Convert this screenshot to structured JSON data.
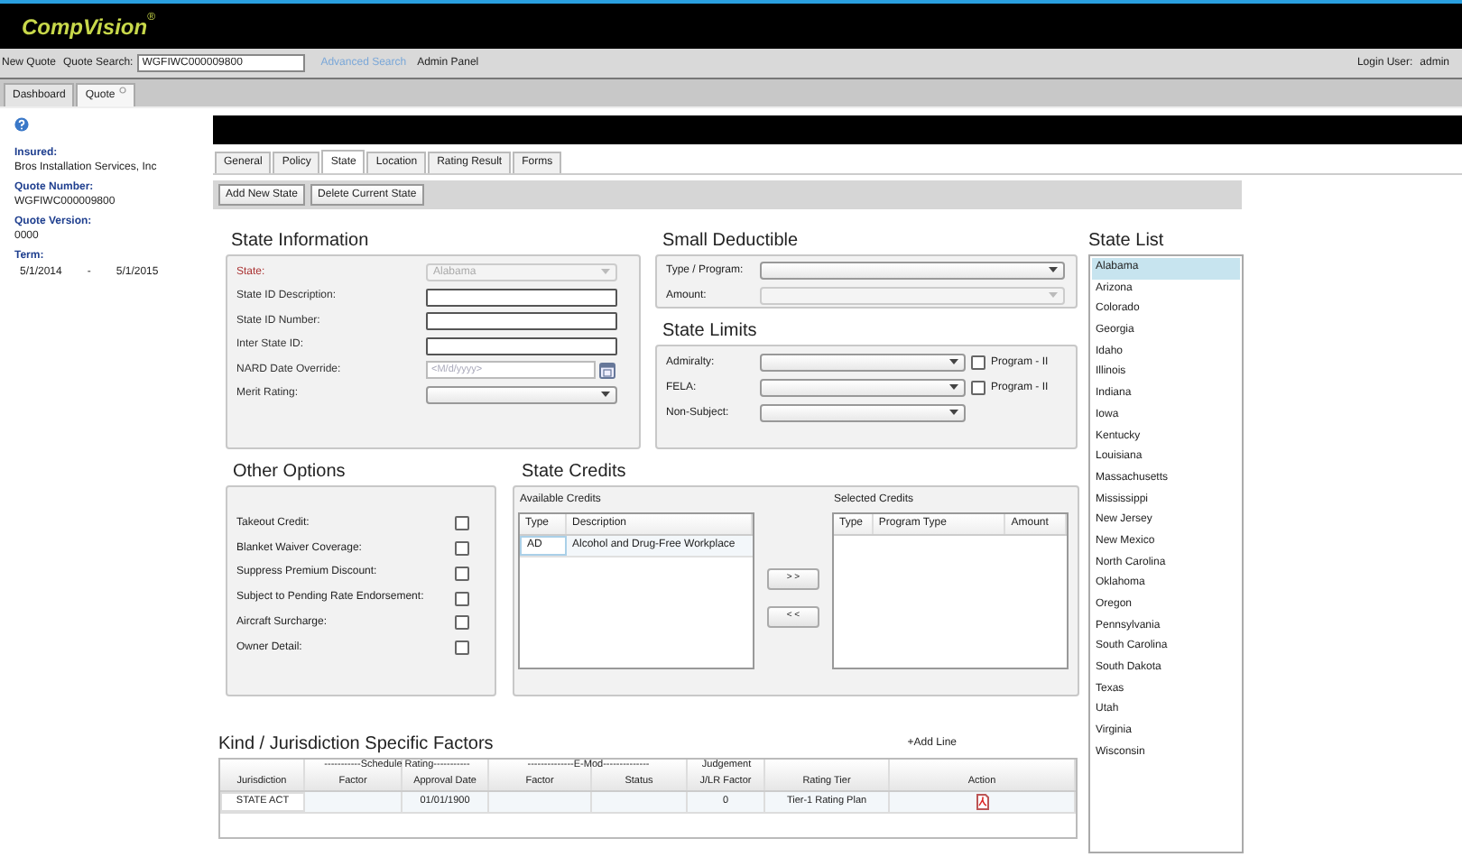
{
  "header": {
    "logo": "CompVision",
    "logo_mark": "®"
  },
  "toolbar": {
    "new_quote": "New Quote",
    "search_label": "Quote Search:",
    "search_value": "WGFIWC000009800",
    "advanced_search": "Advanced Search",
    "admin_panel": "Admin Panel",
    "login_label": "Login User:",
    "login_user": "admin"
  },
  "doc_tabs": [
    {
      "label": "Dashboard",
      "selected": false,
      "closable": false
    },
    {
      "label": "Quote",
      "selected": true,
      "closable": true
    }
  ],
  "sidebar": {
    "fields": [
      {
        "label": "Insured:",
        "value": "Bros Installation Services, Inc"
      },
      {
        "label": "Quote Number:",
        "value": "WGFIWC000009800"
      },
      {
        "label": "Quote Version:",
        "value": "0000"
      }
    ],
    "term": {
      "label": "Term:",
      "start": "5/1/2014",
      "separator": "-",
      "end": "5/1/2015"
    }
  },
  "section_tabs": [
    {
      "label": "General",
      "selected": false
    },
    {
      "label": "Policy",
      "selected": false
    },
    {
      "label": "State",
      "selected": true
    },
    {
      "label": "Location",
      "selected": false
    },
    {
      "label": "Rating Result",
      "selected": false
    },
    {
      "label": "Forms",
      "selected": false
    }
  ],
  "actions": [
    "Add New State",
    "Delete Current State"
  ],
  "state_information": {
    "title": "State Information",
    "fields": [
      {
        "label": "State:",
        "kind": "select",
        "value": "Alabama",
        "required": true,
        "disabled": true
      },
      {
        "label": "State ID Description:",
        "kind": "text",
        "required": false,
        "disabled": false
      },
      {
        "label": "State ID Number:",
        "kind": "text",
        "required": false,
        "disabled": false
      },
      {
        "label": "Inter State ID:",
        "kind": "text",
        "required": false,
        "disabled": false
      },
      {
        "label": "NARD Date Override:",
        "kind": "date",
        "placeholder": "<M/d/yyyy>",
        "required": false,
        "disabled": false
      },
      {
        "label": "Merit Rating:",
        "kind": "select",
        "required": false,
        "disabled": false
      }
    ]
  },
  "small_deductible": {
    "title": "Small Deductible",
    "fields": [
      {
        "label": "Type / Program:",
        "disabled": false
      },
      {
        "label": "Amount:",
        "disabled": true
      }
    ]
  },
  "state_limits": {
    "title": "State Limits",
    "rows": [
      {
        "label": "Admiralty:",
        "kind": "select_check",
        "checkbox_label": "Program - II",
        "checked": false
      },
      {
        "label": "FELA:",
        "kind": "select_check",
        "checkbox_label": "Program - II",
        "checked": false
      },
      {
        "label": "Non-Subject:",
        "kind": "select"
      }
    ]
  },
  "other_options": {
    "title": "Other Options",
    "options": [
      {
        "label": "Takeout Credit:",
        "checked": false
      },
      {
        "label": "Blanket Waiver Coverage:",
        "checked": false
      },
      {
        "label": "Suppress Premium Discount:",
        "checked": false
      },
      {
        "label": "Subject to Pending Rate Endorsement:",
        "checked": false
      },
      {
        "label": "Aircraft Surcharge:",
        "checked": false
      },
      {
        "label": "Owner Detail:",
        "checked": false
      }
    ]
  },
  "state_credits": {
    "title": "State Credits",
    "available": {
      "label": "Available Credits",
      "columns": [
        "Type",
        "Description"
      ],
      "rows": [
        {
          "cells": [
            "AD",
            "Alcohol and Drug-Free Workplace"
          ],
          "selected": false
        }
      ]
    },
    "move_buttons": [
      "> >",
      "< <"
    ],
    "selected": {
      "label": "Selected Credits",
      "columns": [
        "Type",
        "Program Type",
        "Amount"
      ]
    }
  },
  "state_list": {
    "title": "State List",
    "items": [
      {
        "label": "Alabama",
        "selected": true
      },
      {
        "label": "Arizona",
        "selected": false
      },
      {
        "label": "Colorado",
        "selected": false
      },
      {
        "label": "Georgia",
        "selected": false
      },
      {
        "label": "Idaho",
        "selected": false
      },
      {
        "label": "Illinois",
        "selected": false
      },
      {
        "label": "Indiana",
        "selected": false
      },
      {
        "label": "Iowa",
        "selected": false
      },
      {
        "label": "Kentucky",
        "selected": false
      },
      {
        "label": "Louisiana",
        "selected": false
      },
      {
        "label": "Massachusetts",
        "selected": false
      },
      {
        "label": "Mississippi",
        "selected": false
      },
      {
        "label": "New Jersey",
        "selected": false
      },
      {
        "label": "New Mexico",
        "selected": false
      },
      {
        "label": "North Carolina",
        "selected": false
      },
      {
        "label": "Oklahoma",
        "selected": false
      },
      {
        "label": "Oregon",
        "selected": false
      },
      {
        "label": "Pennsylvania",
        "selected": false
      },
      {
        "label": "South Carolina",
        "selected": false
      },
      {
        "label": "South Dakota",
        "selected": false
      },
      {
        "label": "Texas",
        "selected": false
      },
      {
        "label": "Utah",
        "selected": false
      },
      {
        "label": "Virginia",
        "selected": false
      },
      {
        "label": "Wisconsin",
        "selected": false
      }
    ]
  },
  "factors": {
    "title": "Kind / Jurisdiction Specific Factors",
    "add_line": "+Add Line",
    "group_headers": [
      "-----------Schedule Rating-----------",
      "--------------E-Mod--------------",
      "Judgement"
    ],
    "columns": [
      "Jurisdiction",
      "Factor",
      "Approval Date",
      "Factor",
      "Status",
      "J/LR Factor",
      "Rating Tier",
      "Action"
    ],
    "rows": [
      {
        "cells": [
          "STATE ACT",
          null,
          "01/01/1900",
          null,
          null,
          "0",
          "Tier-1 Rating Plan"
        ]
      }
    ]
  }
}
